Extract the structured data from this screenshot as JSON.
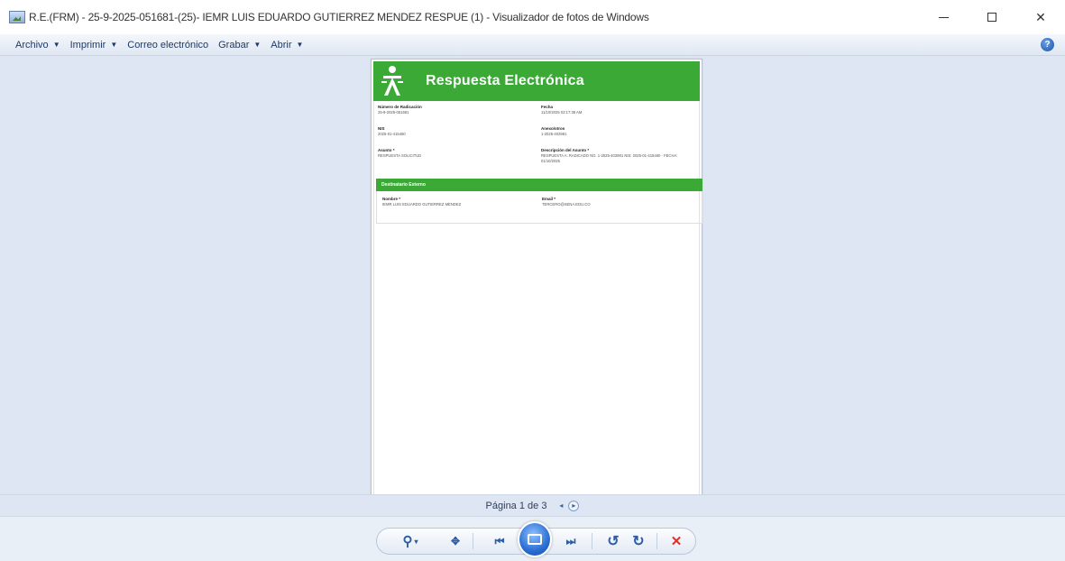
{
  "window": {
    "title": "R.E.(FRM) - 25-9-2025-051681-(25)-  IEMR LUIS EDUARDO GUTIERREZ MENDEZ RESPUE (1) - Visualizador de fotos de Windows",
    "minimize_glyph": "—",
    "close_glyph": "✕"
  },
  "menu": {
    "items": [
      {
        "label": "Archivo"
      },
      {
        "label": "Imprimir"
      },
      {
        "label": "Correo electrónico"
      },
      {
        "label": "Grabar"
      },
      {
        "label": "Abrir"
      }
    ],
    "help_glyph": "?"
  },
  "document": {
    "header_title": "Respuesta Electrónica",
    "fields": [
      {
        "label": "Número de Radicación",
        "value": "25-9-2025-051681"
      },
      {
        "label": "Fecha",
        "value": "11/10/2025 03:17:38 AM"
      },
      {
        "label": "NIS",
        "value": "2025-01-415460"
      },
      {
        "label": "Anexo/otros",
        "value": "1-2025-402981"
      },
      {
        "label": "Asunto *",
        "value": "RESPUESTA SOLICITUD"
      },
      {
        "label": "Descripción del Asunto *",
        "value": "RESPUESTA A: RADICADO NO. 1-2025-402981 NIS: 2025-01-415460 - FECHA: 01/10/2025"
      },
      {
        "label": "Nombre *",
        "value": "IEMR LUIS EDUARDO GUTIERREZ MENDEZ"
      },
      {
        "label": "Email *",
        "value": "TERCERO@SENA.EDU.CO"
      }
    ],
    "section_title": "Destinatario Externo"
  },
  "pager": {
    "text": "Página 1 de 3",
    "prev_glyph": "◂",
    "next_glyph": "▸"
  },
  "toolbar": {
    "zoom_glyph": "⚲",
    "actual_size_glyph": "✥",
    "prev_glyph": "⏮",
    "next_glyph": "⏭",
    "rotate_left_glyph": "↺",
    "rotate_right_glyph": "↻",
    "delete_glyph": "✕"
  },
  "colors": {
    "accent_green": "#3aa935",
    "delete_red": "#d9342b"
  }
}
